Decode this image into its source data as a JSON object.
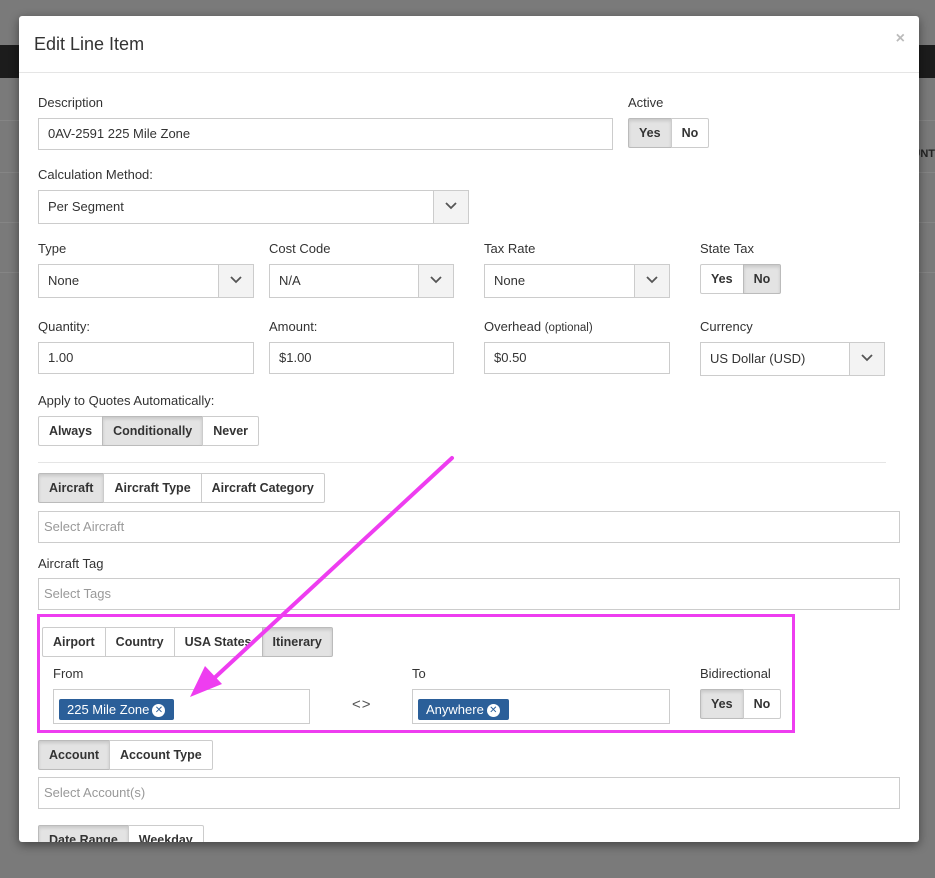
{
  "modal": {
    "title": "Edit Line Item",
    "close_glyph": "×"
  },
  "background": {
    "cut_text": "UNT"
  },
  "form": {
    "description": {
      "label": "Description",
      "value": "0AV-2591 225 Mile Zone"
    },
    "active": {
      "label": "Active",
      "yes": "Yes",
      "no": "No",
      "selected": "Yes"
    },
    "calculation_method": {
      "label": "Calculation Method:",
      "value": "Per Segment"
    },
    "type": {
      "label": "Type",
      "value": "None"
    },
    "cost_code": {
      "label": "Cost Code",
      "value": "N/A"
    },
    "tax_rate": {
      "label": "Tax Rate",
      "value": "None"
    },
    "state_tax": {
      "label": "State Tax",
      "yes": "Yes",
      "no": "No",
      "selected": "No"
    },
    "quantity": {
      "label": "Quantity:",
      "value": "1.00"
    },
    "amount": {
      "label": "Amount:",
      "value": "$1.00"
    },
    "overhead": {
      "label": "Overhead",
      "label_note": "(optional)",
      "value": "$0.50"
    },
    "currency": {
      "label": "Currency",
      "value": "US Dollar (USD)"
    },
    "apply_quotes": {
      "label": "Apply to Quotes Automatically:",
      "options": [
        "Always",
        "Conditionally",
        "Never"
      ],
      "selected": "Conditionally"
    },
    "aircraft_tabs": {
      "options": [
        "Aircraft",
        "Aircraft Type",
        "Aircraft Category"
      ],
      "selected": "Aircraft",
      "placeholder": "Select Aircraft"
    },
    "aircraft_tag": {
      "label": "Aircraft Tag",
      "placeholder": "Select Tags"
    },
    "location_tabs": {
      "options": [
        "Airport",
        "Country",
        "USA States",
        "Itinerary"
      ],
      "selected": "Itinerary"
    },
    "from": {
      "label": "From",
      "tag": "225 Mile Zone"
    },
    "swap_glyph": "<>",
    "to": {
      "label": "To",
      "tag": "Anywhere"
    },
    "bidirectional": {
      "label": "Bidirectional",
      "yes": "Yes",
      "no": "No",
      "selected": "Yes"
    },
    "account_tabs": {
      "options": [
        "Account",
        "Account Type"
      ],
      "selected": "Account",
      "placeholder": "Select Account(s)"
    },
    "date_tabs": {
      "options": [
        "Date Range",
        "Weekday"
      ],
      "selected": "Date Range"
    }
  },
  "annotation": {
    "color": "#ee3df0"
  },
  "colors": {
    "tag_bg": "#2b5f99",
    "highlight": "#ee3df0"
  }
}
